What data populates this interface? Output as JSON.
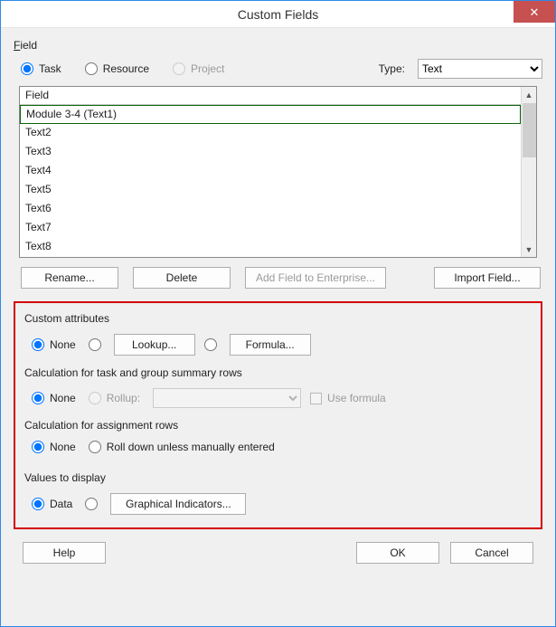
{
  "window": {
    "title": "Custom Fields"
  },
  "field": {
    "label_pre": "F",
    "label_rest": "ield",
    "radios": {
      "task": "Task",
      "resource": "Resource",
      "project": "Project"
    },
    "type_label": "Type:",
    "type_value": "Text"
  },
  "list": {
    "header": "Field",
    "rows": [
      "Module 3-4 (Text1)",
      "Text2",
      "Text3",
      "Text4",
      "Text5",
      "Text6",
      "Text7",
      "Text8"
    ],
    "selected_index": 0
  },
  "list_buttons": {
    "rename": "Rename...",
    "delete": "Delete",
    "add_ent": "Add Field to Enterprise...",
    "import": "Import Field..."
  },
  "custom_attr": {
    "title": "Custom attributes",
    "none": "None",
    "lookup": "Lookup...",
    "formula": "Formula..."
  },
  "calc_task": {
    "title": "Calculation for task and group summary rows",
    "none": "None",
    "rollup": "Rollup:",
    "use_formula": "Use formula"
  },
  "calc_assign": {
    "title": "Calculation for assignment rows",
    "none": "None",
    "rolldown": "Roll down unless manually entered"
  },
  "values_display": {
    "title": "Values to display",
    "data": "Data",
    "gi": "Graphical Indicators..."
  },
  "bottom": {
    "help": "Help",
    "ok": "OK",
    "cancel": "Cancel"
  }
}
